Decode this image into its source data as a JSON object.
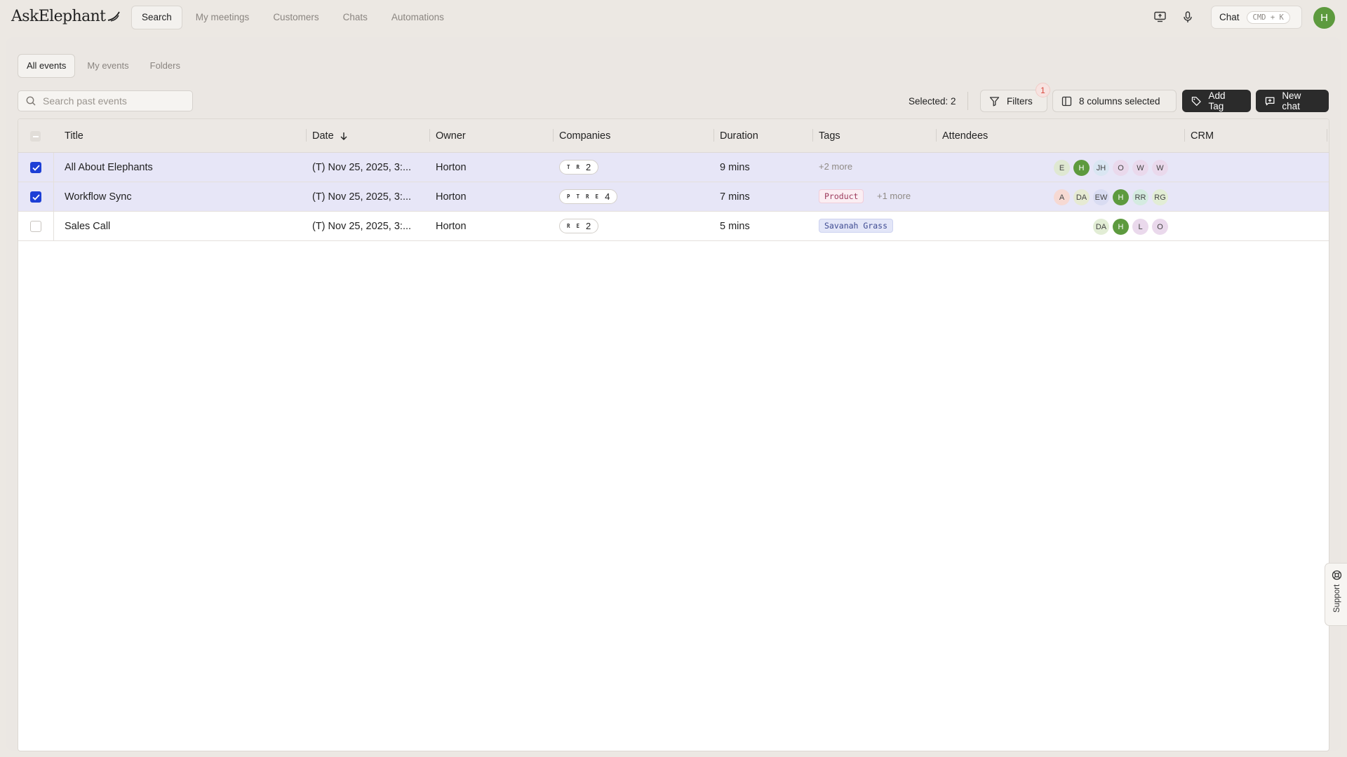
{
  "brand": {
    "name": "AskElephant"
  },
  "nav": {
    "items": [
      {
        "label": "Search",
        "active": true
      },
      {
        "label": "My meetings"
      },
      {
        "label": "Customers"
      },
      {
        "label": "Chats"
      },
      {
        "label": "Automations"
      }
    ]
  },
  "header": {
    "chat_label": "Chat",
    "chat_shortcut": "CMD + K",
    "user_initial": "H"
  },
  "subtabs": [
    {
      "label": "All events",
      "active": true
    },
    {
      "label": "My events"
    },
    {
      "label": "Folders"
    }
  ],
  "search": {
    "placeholder": "Search past events",
    "value": ""
  },
  "toolbar": {
    "selected_label": "Selected: 2",
    "filters_label": "Filters",
    "filters_count": "1",
    "columns_label": "8 columns selected",
    "add_tag_label": "Add Tag",
    "new_chat_label": "New chat"
  },
  "table": {
    "columns": [
      "Title",
      "Date",
      "Owner",
      "Companies",
      "Duration",
      "Tags",
      "Attendees",
      "CRM"
    ],
    "rows": [
      {
        "selected": true,
        "title": "All About Elephants",
        "date": "(T) Nov 25, 2025, 3:...",
        "owner": "Horton",
        "company_letters": [
          "T",
          "R"
        ],
        "company_count": "2",
        "duration": "9 mins",
        "tags": [],
        "tags_more": "+2 more",
        "attendees": [
          "E",
          "H",
          "JH",
          "O",
          "W",
          "W"
        ]
      },
      {
        "selected": true,
        "title": "Workflow Sync",
        "date": "(T) Nov 25, 2025, 3:...",
        "owner": "Horton",
        "company_letters": [
          "P",
          "T",
          "R",
          "E"
        ],
        "company_count": "4",
        "duration": "7 mins",
        "tags": [
          "Product"
        ],
        "tags_more": "+1 more",
        "attendees": [
          "A",
          "DA",
          "EW",
          "H",
          "RR",
          "RG"
        ]
      },
      {
        "selected": false,
        "title": "Sales Call",
        "date": "(T) Nov 25, 2025, 3:...",
        "owner": "Horton",
        "company_letters": [
          "R",
          "E"
        ],
        "company_count": "2",
        "duration": "5 mins",
        "tags": [
          "Savanah Grass"
        ],
        "tags_more": "",
        "attendees": [
          "DA",
          "H",
          "L",
          "O"
        ]
      }
    ]
  },
  "support": {
    "label": "Support"
  },
  "colors": {
    "accent_checkbox": "#1d3fd6",
    "selected_row": "#e7e6f7",
    "avatar_green": "#5d9a3e",
    "badge_red": "#d9463a"
  }
}
